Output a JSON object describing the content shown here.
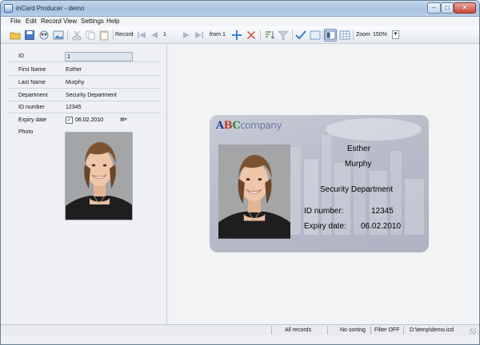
{
  "window": {
    "title": "inCard Producer - demo"
  },
  "menu": [
    "File",
    "Edit",
    "Record",
    "View",
    "Settings",
    "Help"
  ],
  "toolbar": {
    "record_label": "Record",
    "record_number": "1",
    "from_label": "from",
    "record_total": "1",
    "zoom_label": "Zoom",
    "zoom_value": "150%"
  },
  "fields": {
    "id": {
      "label": "ID",
      "value": "1"
    },
    "first_name": {
      "label": "First Name",
      "value": "Esther"
    },
    "last_name": {
      "label": "Last Name",
      "value": "Murphy"
    },
    "department": {
      "label": "Department",
      "value": "Security Department"
    },
    "id_number": {
      "label": "ID number",
      "value": "12345"
    },
    "expiry_date": {
      "label": "Expiry date",
      "value": "06.02.2010",
      "checked": true
    },
    "photo": {
      "label": "Photo"
    }
  },
  "card": {
    "logo_letters": [
      "A",
      "B",
      "C"
    ],
    "logo_rest": "company",
    "first_name": "Esther",
    "last_name": "Murphy",
    "department": "Security Department",
    "id_label": "ID number:",
    "id_value": "12345",
    "expiry_label": "Expiry date:",
    "expiry_value": "06.02.2010"
  },
  "status": {
    "records": "All records",
    "sorting": "No sorting",
    "filter": "Filter OFF",
    "file": "D:\\temp\\demo.icd"
  },
  "colors": {
    "logo_a": "#1c3f8c",
    "logo_b": "#c0392b",
    "logo_c": "#2c8a3e"
  }
}
